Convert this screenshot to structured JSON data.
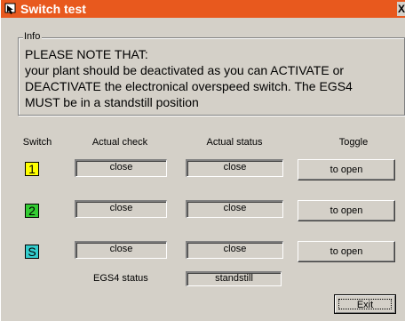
{
  "window": {
    "title": "Switch test",
    "close_label": "X",
    "colors": {
      "titlebar": "#e8591e",
      "face": "#d4d0c8"
    }
  },
  "info": {
    "legend": "Info",
    "lines": [
      "PLEASE NOTE THAT:",
      "your plant should be deactivated as you can ACTIVATE or",
      "DEACTIVATE the electronical overspeed switch. The EGS4",
      "MUST be in a standstill position"
    ]
  },
  "columns": {
    "switch": "Switch",
    "actual_check": "Actual check",
    "actual_status": "Actual status",
    "toggle": "Toggle"
  },
  "switches": [
    {
      "label": "1",
      "color": "#ffff00",
      "actual_check": "close",
      "actual_status": "close",
      "toggle_label": "to open"
    },
    {
      "label": "2",
      "color": "#33cc33",
      "actual_check": "close",
      "actual_status": "close",
      "toggle_label": "to open"
    },
    {
      "label": "S",
      "color": "#33cccc",
      "actual_check": "close",
      "actual_status": "close",
      "toggle_label": "to open"
    }
  ],
  "egs4": {
    "label": "EGS4 status",
    "value": "standstill"
  },
  "exit_label": "Exit",
  "icons": {
    "title": "cursor-icon",
    "close": "close-icon"
  }
}
